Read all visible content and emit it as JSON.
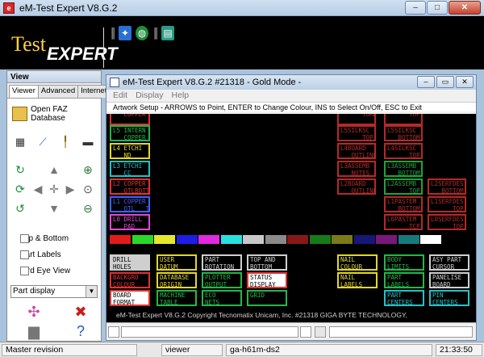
{
  "app": {
    "title": "eM-Test Expert V8.G.2",
    "logo_test": "Test",
    "logo_expert": "EXPERT"
  },
  "left_panel": {
    "header": "View",
    "tabs": [
      "Viewer",
      "Advanced",
      "Internet"
    ],
    "open_faz_label": "Open FAZ Database",
    "checkboxes": [
      {
        "label": "Top & Bottom",
        "checked": false
      },
      {
        "label": "Part Labels",
        "checked": false
      },
      {
        "label": "Bird Eye View",
        "checked": false
      }
    ],
    "display_select": "Part display"
  },
  "inner": {
    "title": "eM-Test Expert V8.G.2   #21318  - Gold Mode -",
    "menu": [
      "Edit",
      "Display",
      "Help"
    ],
    "instruction": "Artwork Setup - ARROWS to Point, ENTER to Change Colour, INS to Select On/Off, ESC to Exit",
    "copyright": "eM-Test Expert V8.G.2   Copyright Tecnomatix Unicam, Inc. #21318 GIGA BYTE TECHNOLOGY,"
  },
  "layers_left": [
    {
      "label": "   COPPER",
      "color": "#e23232"
    },
    {
      "label": "L5 INTERN\n   COPPER",
      "color": "#22b84a"
    },
    {
      "label": "L4 ETCHI\n   ND",
      "color": "#e3d62c"
    },
    {
      "label": "L3 ETCHI\n   CC",
      "color": "#22c2c9"
    },
    {
      "label": "L2 COPPER\n   OTLBOTTOM",
      "color": "#e23232"
    },
    {
      "label": "L1 COPPER\n   OTL___TOP",
      "color": "#3d63ff"
    },
    {
      "label": "L0 DRILL\n   PAD",
      "color": "#e04ad2"
    }
  ],
  "layers_right_a": [
    {
      "label": "      TOKBOR",
      "color": "#b32a2a"
    },
    {
      "label": "L5SILKSC\n      TOP",
      "color": "#b32a2a"
    },
    {
      "label": "L4BOARD\n   OUTLINE",
      "color": "#b32a2a"
    },
    {
      "label": "L3ASSEMB\n   NOTES",
      "color": "#b32a2a"
    },
    {
      "label": "L2BOARD\n   OUTLINE",
      "color": "#b32a2a"
    }
  ],
  "layers_right_b": [
    {
      "label": "      TOP",
      "color": "#b32a2a"
    },
    {
      "label": "L5SILKSC\n   BOTTOM",
      "color": "#b32a2a"
    },
    {
      "label": "L4SILKSC\n      TOP",
      "color": "#b32a2a"
    },
    {
      "label": "L3ASSEMB\n   BOTTOM",
      "color": "#22a23a"
    },
    {
      "label": "L2ASSEMB\n      TOP",
      "color": "#22a23a"
    },
    {
      "label": "L1PASTEM\n   BOTTOM",
      "color": "#b32a2a"
    },
    {
      "label": "L0PASTEM\n      TCP",
      "color": "#b32a2a"
    }
  ],
  "layers_right_c": [
    {
      "label": "L2SERFDES\n   BOTTOM",
      "color": "#b32a2a"
    },
    {
      "label": "L1SERFDES\n      TOP",
      "color": "#b32a2a"
    },
    {
      "label": "L0SERFDES\n      TOP",
      "color": "#b32a2a"
    }
  ],
  "palette": [
    "#e21b1b",
    "#29d829",
    "#e6e62c",
    "#1d1de6",
    "#e029e0",
    "#29e0e0",
    "#c8c8c8",
    "#8a8a8a",
    "#8a1717",
    "#177a17",
    "#7a7a17",
    "#17177a",
    "#7a177a",
    "#177a7a",
    "#ffffff"
  ],
  "buttons": [
    {
      "label": "DRILL\nHOLES",
      "color": "#cfcfcf",
      "bg": "#cfcfcf",
      "text": "#000000"
    },
    {
      "label": "USER\nDATUM",
      "color": "#e3d62c"
    },
    {
      "label": "PART\nROTATION",
      "color": "#cfcfcf"
    },
    {
      "label": "TOP AND\nBOTTOM",
      "color": "#cfcfcf"
    },
    {
      "label": "NAIL\nCOLOUR",
      "color": "#e3d62c"
    },
    {
      "label": "BODY\nLIMITS",
      "color": "#22b84a"
    },
    {
      "label": "ASY PART\nCURSOR",
      "color": "#cfcfcf"
    },
    {
      "label": "BACKGRO\nCOLOUR",
      "color": "#e23232"
    },
    {
      "label": "DATABASE\nORIGIN",
      "color": "#e3d62c"
    },
    {
      "label": "PLOTTER\nOUTPUT",
      "color": "#22b84a"
    },
    {
      "label": "STATUS\nDISPLAY",
      "color": "#e23232",
      "bg": "#ffffff",
      "text": "#000000"
    },
    {
      "label": "NAIL\nLABELS",
      "color": "#e3d62c"
    },
    {
      "label": "PART\nLABELS",
      "color": "#22b84a"
    },
    {
      "label": "PANELISE\nBOARD",
      "color": "#cfcfcf"
    },
    {
      "label": "BOARD\nFORMAT",
      "color": "#e23232",
      "bg": "#ffffff",
      "text": "#000000"
    },
    {
      "label": "MACHINE\nTABLE",
      "color": "#22b84a"
    },
    {
      "label": "ECO\nNETS",
      "color": "#22b84a"
    },
    {
      "label": "GRID",
      "color": "#22b84a"
    },
    {
      "label": "PART\nCENTERS",
      "color": "#22c2c9"
    },
    {
      "label": "PIN\nCENTERS",
      "color": "#22c2c9"
    }
  ],
  "statusbar": {
    "left": "Master revision",
    "mode": "viewer",
    "host": "ga-h61m-ds2",
    "time": "21:33:50"
  }
}
